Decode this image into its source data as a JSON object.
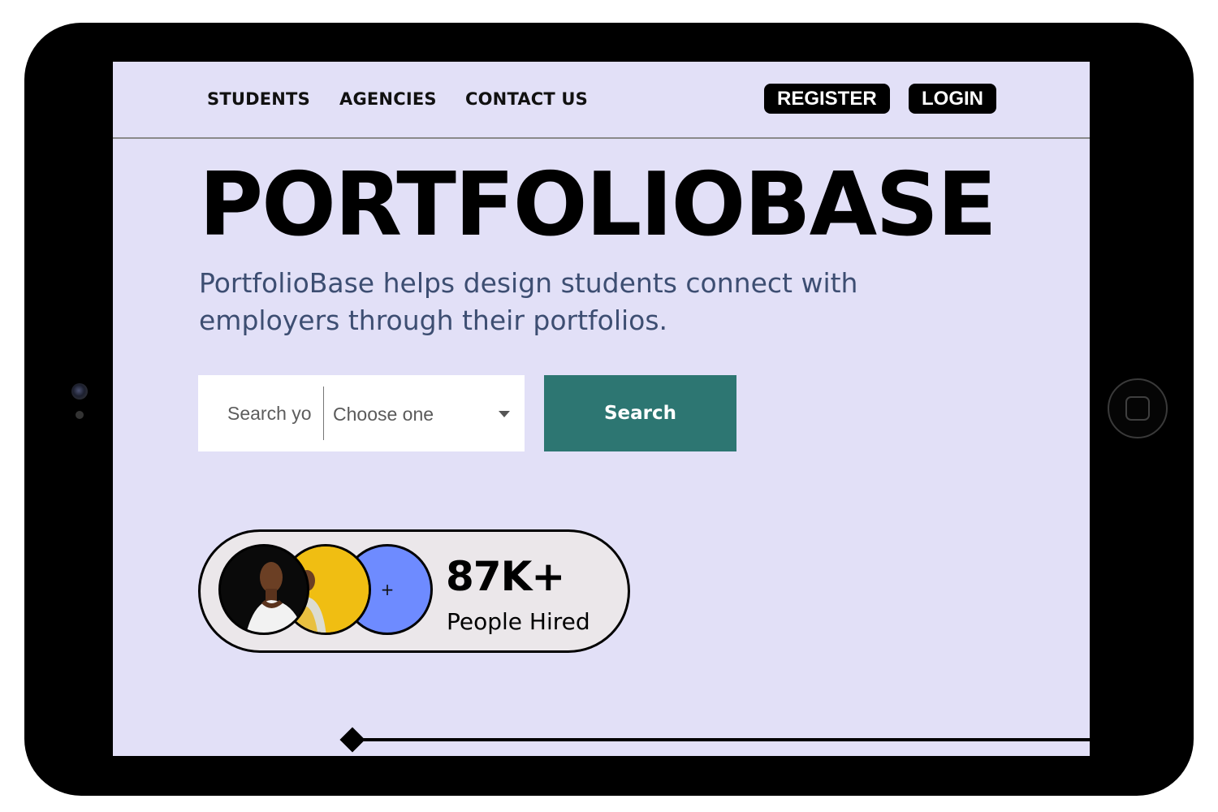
{
  "nav": {
    "links": [
      "STUDENTS",
      "AGENCIES",
      "CONTACT US"
    ],
    "register_label": "REGISTER",
    "login_label": "LOGIN"
  },
  "hero": {
    "title": "PORTFOLIOBASE",
    "subtitle": "PortfolioBase helps design students connect with employers through their portfolios."
  },
  "search": {
    "placeholder": "Search yo",
    "select_value": "Choose one",
    "button_label": "Search"
  },
  "stats": {
    "number": "87K+",
    "label": "People Hired",
    "plus": "+"
  },
  "colors": {
    "screen_bg": "#e2e0f7",
    "search_button": "#2d7672",
    "avatar_yellow": "#f0be12",
    "avatar_blue": "#6e8bff"
  }
}
